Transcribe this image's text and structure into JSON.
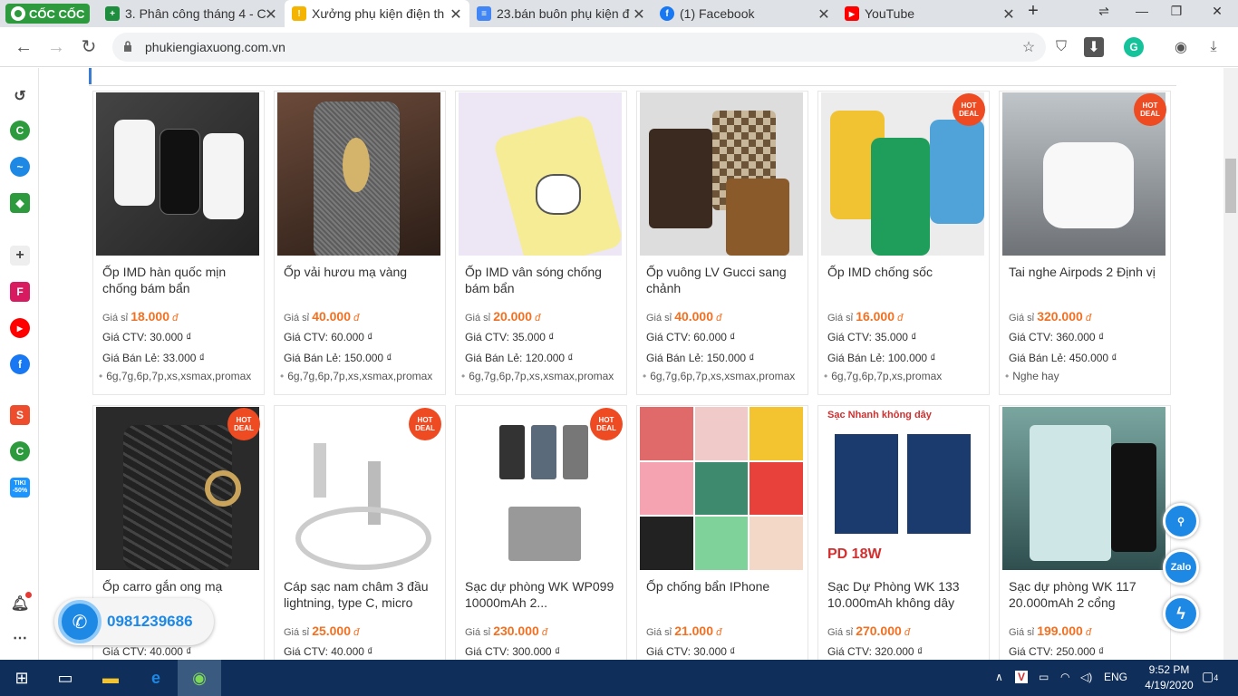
{
  "browser": {
    "brand": "CỐC CỐC",
    "tabs": [
      {
        "title": "3. Phân công tháng 4 - C",
        "icon_color": "#1e8e3e",
        "icon": "+"
      },
      {
        "title": "Xưởng phụ kiện điện th",
        "icon_color": "#f4b400",
        "icon": "!"
      },
      {
        "title": "23.bán buôn phụ kiện đ",
        "icon_color": "#4285f4",
        "icon": "≡"
      },
      {
        "title": "(1) Facebook",
        "icon_color": "#1877f2",
        "icon": "f"
      },
      {
        "title": "YouTube",
        "icon_color": "#ff0000",
        "icon": "▶"
      }
    ],
    "url": "phukiengiaxuong.com.vn"
  },
  "products": [
    {
      "name": "Ốp IMD hàn quốc mịn chống bám bẩn",
      "label_price": "Giá sỉ",
      "price": "18.000",
      "currency": "đ",
      "ctv": "Giá CTV: 30.000 ₫",
      "retail": "Giá Bán Lẻ: 33.000 ₫",
      "variant": "6g,7g,6p,7p,xs,xsmax,promax",
      "hot": false,
      "img": "adidas"
    },
    {
      "name": "Ốp vải hươu mạ vàng",
      "label_price": "Giá sỉ",
      "price": "40.000",
      "currency": "đ",
      "ctv": "Giá CTV: 60.000 ₫",
      "retail": "Giá Bán Lẻ: 150.000 ₫",
      "variant": "6g,7g,6p,7p,xs,xsmax,promax",
      "hot": false,
      "img": "deer"
    },
    {
      "name": "Ốp IMD vân sóng chống bám bẩn",
      "label_price": "Giá sỉ",
      "price": "20.000",
      "currency": "đ",
      "ctv": "Giá CTV: 35.000 ₫",
      "retail": "Giá Bán Lẻ: 120.000 ₫",
      "variant": "6g,7g,6p,7p,xs,xsmax,promax",
      "hot": false,
      "img": "cat"
    },
    {
      "name": "Ốp vuông LV Gucci sang chảnh",
      "label_price": "Giá sỉ",
      "price": "40.000",
      "currency": "đ",
      "ctv": "Giá CTV: 60.000 ₫",
      "retail": "Giá Bán Lẻ: 150.000 ₫",
      "variant": "6g,7g,6p,7p,xs,xsmax,promax",
      "hot": false,
      "img": "lv"
    },
    {
      "name": "Ốp IMD chống sốc",
      "label_price": "Giá sỉ",
      "price": "16.000",
      "currency": "đ",
      "ctv": "Giá CTV: 35.000 ₫",
      "retail": "Giá Bán Lẻ: 100.000 ₫",
      "variant": "6g,7g,6p,7p,xs,promax",
      "hot": true,
      "img": "brown"
    },
    {
      "name": "Tai nghe Airpods 2 Định vị",
      "label_price": "Giá sỉ",
      "price": "320.000",
      "currency": "đ",
      "ctv": "Giá CTV: 360.000 ₫",
      "retail": "Giá Bán Lẻ: 450.000 ₫",
      "variant": "Nghe hay",
      "hot": true,
      "img": "airpods"
    },
    {
      "name": "Ốp carro gắn ong mạ",
      "label_price": "",
      "price": "",
      "currency": "",
      "ctv": "Giá CTV: 40.000 ₫",
      "retail": "",
      "variant": "",
      "hot": true,
      "img": "bee"
    },
    {
      "name": "Cáp sạc nam châm 3 đầu lightning, type C, micro",
      "label_price": "Giá sỉ",
      "price": "25.000",
      "currency": "đ",
      "ctv": "Giá CTV: 40.000 ₫",
      "retail": "",
      "variant": "",
      "hot": true,
      "img": "cable"
    },
    {
      "name": "Sạc dự phòng WK WP099 10000mAh 2...",
      "label_price": "Giá sỉ",
      "price": "230.000",
      "currency": "đ",
      "ctv": "Giá CTV: 300.000 ₫",
      "retail": "",
      "variant": "",
      "hot": true,
      "img": "power"
    },
    {
      "name": "Ốp chống bẩn IPhone",
      "label_price": "Giá sỉ",
      "price": "21.000",
      "currency": "đ",
      "ctv": "Giá CTV: 30.000 ₫",
      "retail": "",
      "variant": "",
      "hot": false,
      "img": "colors"
    },
    {
      "name": "Sạc Dự Phòng WK 133 10.000mAh không dây",
      "label_price": "Giá sỉ",
      "price": "270.000",
      "currency": "đ",
      "ctv": "Giá CTV: 320.000 ₫",
      "retail": "",
      "variant": "",
      "hot": false,
      "img": "pd18"
    },
    {
      "name": "Sạc dự phòng WK 117 20.000mAh 2 cổng",
      "label_price": "Giá sỉ",
      "price": "199.000",
      "currency": "đ",
      "ctv": "Giá CTV: 250.000 ₫",
      "retail": "",
      "variant": "",
      "hot": false,
      "img": "wk117"
    }
  ],
  "hot_label": "HOT DEAL",
  "wireless_banner": "Sạc Nhanh không dây",
  "pd_text": "PD 18W",
  "phone_number": "0981239686",
  "float_zalo": "Zalo",
  "sidebar": {
    "tiki": "TIKI -50%"
  },
  "taskbar": {
    "lang": "ENG",
    "time": "9:52 PM",
    "date": "4/19/2020",
    "notif": "4"
  }
}
